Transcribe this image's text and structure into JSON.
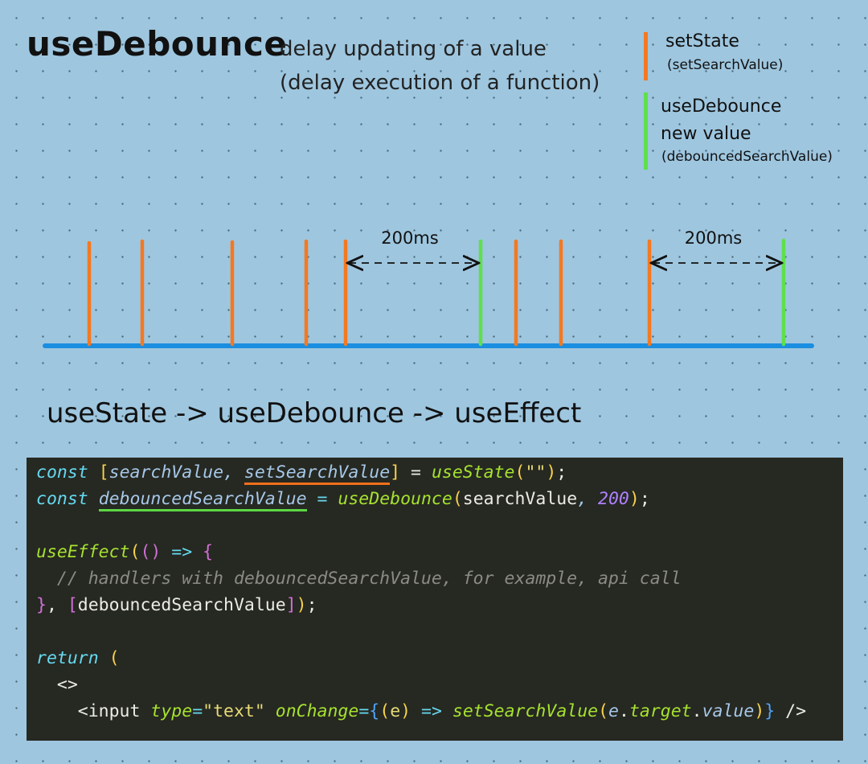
{
  "header": {
    "title": "useDebounce",
    "subtitle_line1": "delay updating of a value",
    "subtitle_line2": "(delay execution of a function)"
  },
  "legend": {
    "set_state": {
      "label": "setState",
      "sub": "(setSearchValue)",
      "color": "#f47920"
    },
    "use_debounce": {
      "label_line1": "useDebounce",
      "label_line2": "new value",
      "sub": "(debouncedSearchValue)",
      "color": "#5ee04b"
    }
  },
  "timeline": {
    "axis_color": "#1a8ee0",
    "events": [
      {
        "type": "set",
        "t": 1
      },
      {
        "type": "set",
        "t": 2
      },
      {
        "type": "set",
        "t": 3
      },
      {
        "type": "set",
        "t": 4
      },
      {
        "type": "set",
        "t": 5
      },
      {
        "type": "debounce",
        "t": 6
      },
      {
        "type": "set",
        "t": 7
      },
      {
        "type": "set",
        "t": 8
      },
      {
        "type": "set",
        "t": 9
      },
      {
        "type": "debounce",
        "t": 10
      }
    ],
    "intervals": [
      {
        "label": "200ms",
        "from_event": 4,
        "to_event": 5
      },
      {
        "label": "200ms",
        "from_event": 8,
        "to_event": 9
      }
    ]
  },
  "flow_text": "useState -> useDebounce -> useEffect",
  "code": {
    "l1": {
      "const": "const",
      "open": "[",
      "v1": "searchValue",
      "comma": ", ",
      "v2": "setSearchValue",
      "close": "]",
      "eq": " = ",
      "fn": "useState",
      "p1": "(",
      "str": "\"\"",
      "p2": ")",
      "semi": ";"
    },
    "l2": {
      "const": "const",
      "v1": "debouncedSearchValue",
      "eq": " = ",
      "fn": "useDebounce",
      "p1": "(",
      "arg": "searchValue",
      "comma": ", ",
      "num": "200",
      "p2": ")",
      "semi": ";"
    },
    "l4": {
      "fn": "useEffect",
      "p1": "(",
      "p2": "()",
      "arrow": " => ",
      "brace": "{"
    },
    "l5": {
      "comment": "// handlers with debouncedSearchValue, for example, api call"
    },
    "l6": {
      "brace": "}",
      "comma": ", ",
      "open": "[",
      "dep": "debouncedSearchValue",
      "close": "]",
      "p": ")",
      "semi": ";"
    },
    "l8": {
      "ret": "return",
      "p": "("
    },
    "l9": {
      "frag": "<>"
    },
    "l10": {
      "tag_open": "<input",
      "attr1": "type",
      "eq1": "=",
      "val1": "\"text\"",
      "attr2": "onChange",
      "eq2": "=",
      "b1": "{",
      "p1": "(",
      "e": "e",
      "p2": ")",
      "arrow": " => ",
      "fn": "setSearchValue",
      "p3": "(",
      "obj": "e",
      "dot1": ".",
      "prop1": "target",
      "dot2": ".",
      "prop2": "value",
      "p4": ")",
      "b2": "}",
      "tag_close": " />"
    }
  }
}
